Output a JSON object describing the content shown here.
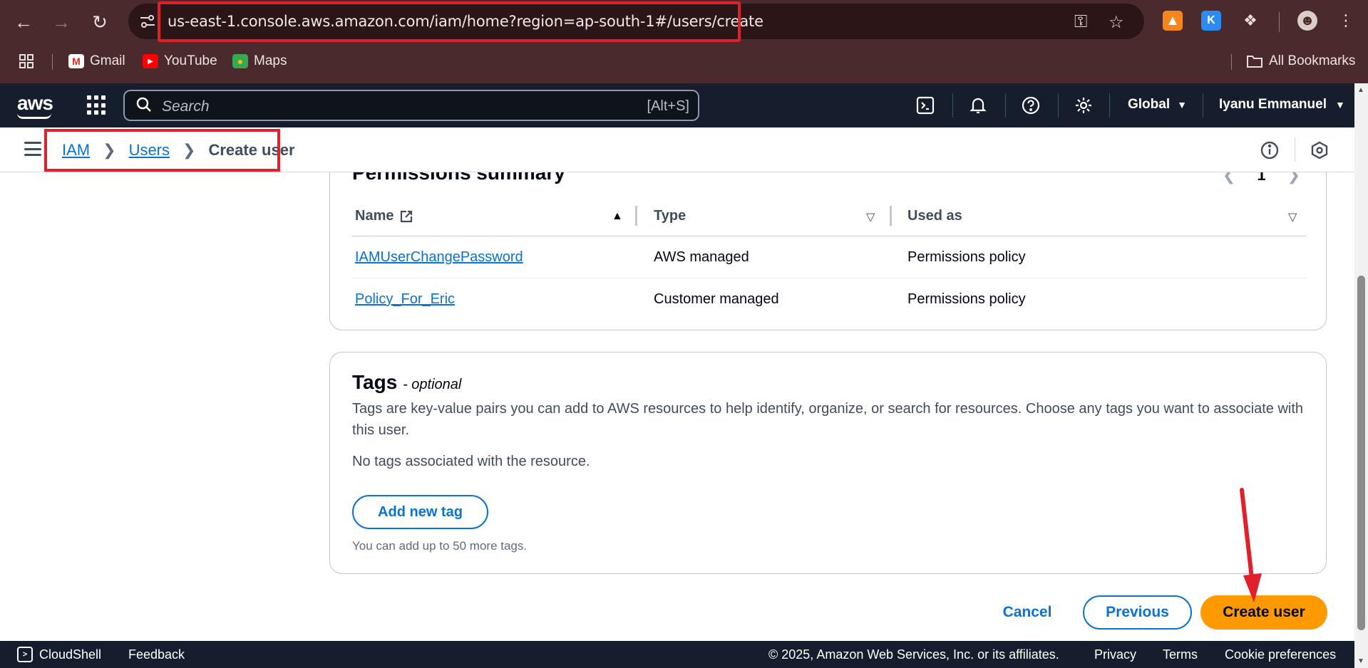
{
  "browser": {
    "url": "us-east-1.console.aws.amazon.com/iam/home?region=ap-south-1#/users/create",
    "bookmarks": [
      {
        "label": "Gmail",
        "icon": "gmail-icon"
      },
      {
        "label": "YouTube",
        "icon": "youtube-icon"
      },
      {
        "label": "Maps",
        "icon": "maps-icon"
      }
    ],
    "all_bookmarks": "All Bookmarks"
  },
  "aws_nav": {
    "logo": "aws",
    "search_placeholder": "Search",
    "search_shortcut": "[Alt+S]",
    "region": "Global",
    "user": "Iyanu Emmanuel"
  },
  "breadcrumb": {
    "items": [
      "IAM",
      "Users"
    ],
    "current": "Create user"
  },
  "permissions": {
    "title": "Permissions summary",
    "page": "1",
    "columns": [
      "Name",
      "Type",
      "Used as"
    ],
    "rows": [
      {
        "name": "IAMUserChangePassword",
        "type": "AWS managed",
        "used_as": "Permissions policy"
      },
      {
        "name": "Policy_For_Eric",
        "type": "Customer managed",
        "used_as": "Permissions policy"
      }
    ]
  },
  "tags": {
    "title": "Tags",
    "optional": "- optional",
    "description": "Tags are key-value pairs you can add to AWS resources to help identify, organize, or search for resources. Choose any tags you want to associate with this user.",
    "empty": "No tags associated with the resource.",
    "add_button": "Add new tag",
    "limit": "You can add up to 50 more tags."
  },
  "actions": {
    "cancel": "Cancel",
    "previous": "Previous",
    "create": "Create user"
  },
  "footer": {
    "cloudshell": "CloudShell",
    "feedback": "Feedback",
    "copyright": "© 2025, Amazon Web Services, Inc. or its affiliates.",
    "privacy": "Privacy",
    "terms": "Terms",
    "cookies": "Cookie preferences"
  },
  "colors": {
    "annotation_red": "#e0202a",
    "aws_orange": "#ff9900",
    "link_blue": "#0972d3",
    "nav_dark": "#161e2d"
  }
}
